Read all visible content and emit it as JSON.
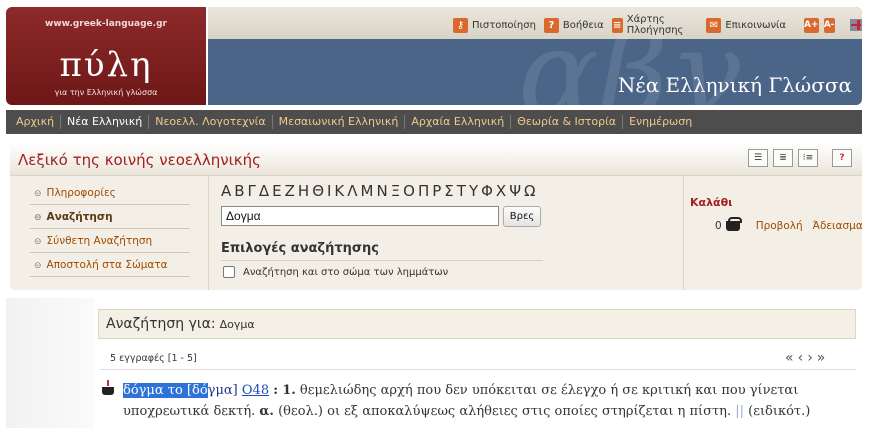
{
  "header": {
    "site_url": "www.greek-language.gr",
    "logo_text": "πύλη",
    "logo_subtitle": "για την Ελληνική γλώσσα",
    "banner_title": "Νέα Ελληνική Γλώσσα",
    "toplinks": [
      {
        "label": "Πιστοποίηση",
        "icon": "key-icon"
      },
      {
        "label": "Βοήθεια",
        "icon": "help-icon"
      },
      {
        "label": "Χάρτης Πλοήγησης",
        "icon": "sitemap-icon"
      },
      {
        "label": "Επικοινωνία",
        "icon": "envelope-icon"
      }
    ],
    "font_increase": "A+",
    "font_decrease": "A-"
  },
  "nav": [
    "Αρχική",
    "Νέα Ελληνική",
    "Νεοελλ. Λογοτεχνία",
    "Μεσαιωνική Ελληνική",
    "Αρχαία Ελληνική",
    "Θεωρία & Ιστορία",
    "Ενημέρωση"
  ],
  "panel": {
    "title": "Λεξικό της κοινής νεοελληνικής",
    "help_label": "?"
  },
  "sidebar": [
    {
      "label": "Πληροφορίες",
      "active": false
    },
    {
      "label": "Αναζήτηση",
      "active": true
    },
    {
      "label": "Σύνθετη Αναζήτηση",
      "active": false
    },
    {
      "label": "Αποστολή στα Σώματα",
      "active": false
    }
  ],
  "search": {
    "alphabet": "ΑΒΓΔΕΖΗΘΙΚΛΜΝΞΟΠΡΣΤΥΦΧΨΩ",
    "value": "Δογμα",
    "button": "Βρες",
    "options_title": "Επιλογές αναζήτησης",
    "option_body": "Αναζήτηση και στο σώμα των λημμάτων"
  },
  "cart": {
    "title": "Καλάθι",
    "count": "0",
    "view": "Προβολή",
    "clear": "Άδειασμα"
  },
  "results": {
    "label": "Αναζήτηση για:",
    "query": "Δογμα",
    "count": "5 εγγραφές [1 - 5]",
    "entry": {
      "headword_highlight": "δόγμα το [δό",
      "headword_rest": "γμα]",
      "code": "Ο48",
      "colon": ":",
      "sense_num": "1.",
      "line1": "θεμελιώδης αρχή που δεν υπόκειται σε έλεγχο ή σε κριτική και που γίνεται",
      "line2a": "υποχρεωτικά δεκτή.",
      "sub": "α.",
      "line2b": "(θεολ.) οι εξ αποκαλύψεως αλήθειες στις οποίες στηρίζεται η πίστη.",
      "sep": "||",
      "line2c": "(ειδικότ.)"
    }
  }
}
